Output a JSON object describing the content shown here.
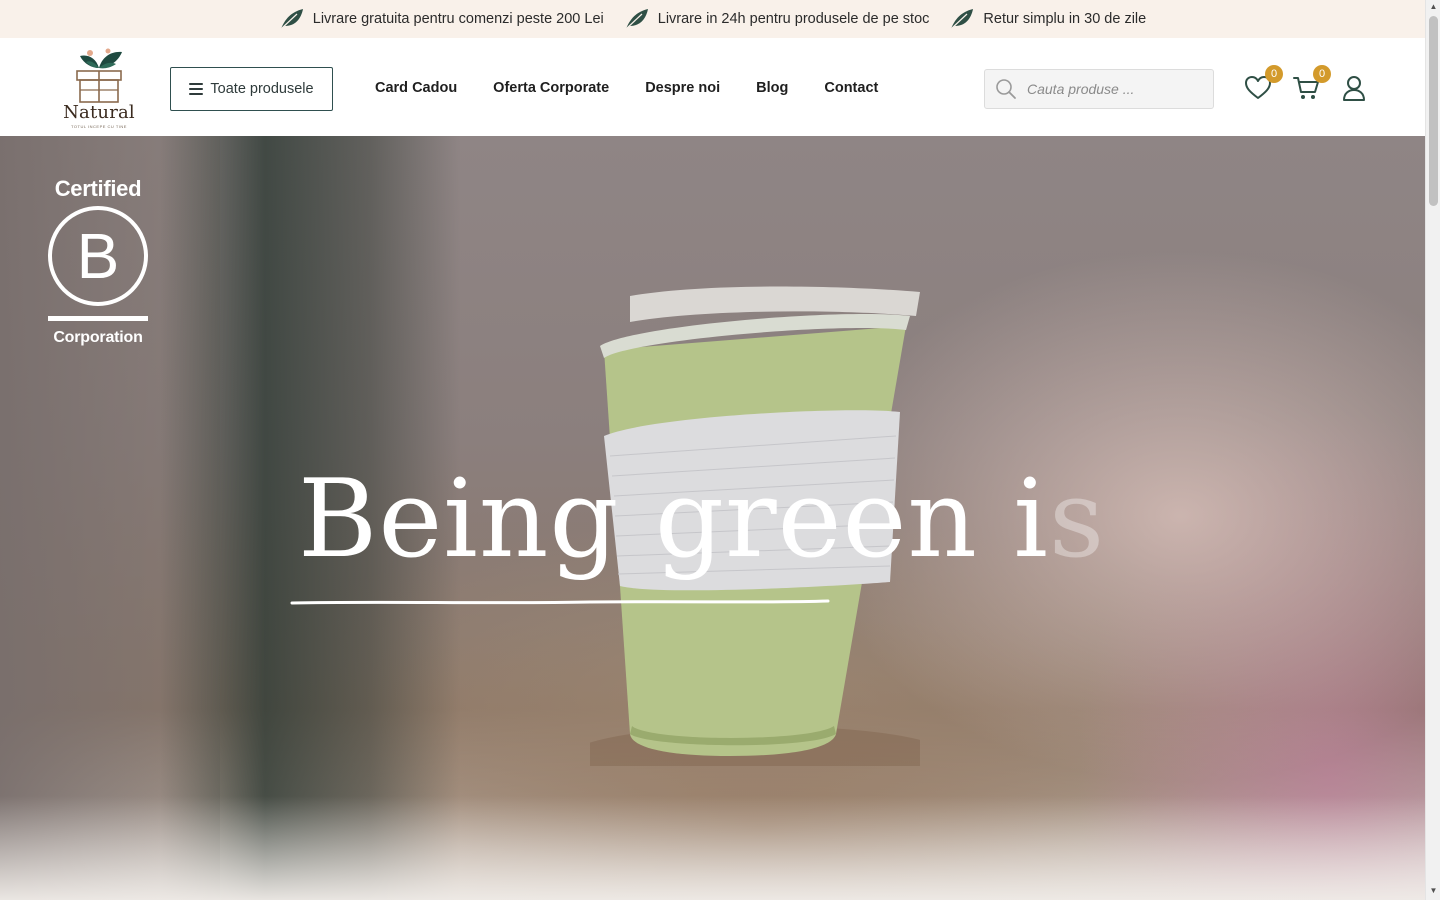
{
  "promo_bar": {
    "items": [
      {
        "text": "Livrare gratuita pentru comenzi peste 200 Lei",
        "icon": "leaf-icon"
      },
      {
        "text": "Livrare in 24h pentru produsele de pe stoc",
        "icon": "leaf-icon"
      },
      {
        "text": "Retur simplu in 30 de zile",
        "icon": "leaf-icon"
      }
    ]
  },
  "header": {
    "logo_text": "Natural",
    "logo_tagline": "TOTUL INCEPE CU TINE",
    "all_products_label": "Toate produsele",
    "nav": [
      "Card Cadou",
      "Oferta Corporate",
      "Despre noi",
      "Blog",
      "Contact"
    ],
    "search_placeholder": "Cauta produse ...",
    "wishlist_count": "0",
    "cart_count": "0"
  },
  "hero": {
    "badge_top": "Certified",
    "badge_letter": "B",
    "badge_bottom": "Corporation",
    "headline_main": "Being green i",
    "headline_fade": "s"
  },
  "colors": {
    "promo_bg": "#f9f1ea",
    "badge_accent": "#d39a2b",
    "leaf_green": "#2f4f45",
    "brand_dark": "#2f3b3b"
  }
}
